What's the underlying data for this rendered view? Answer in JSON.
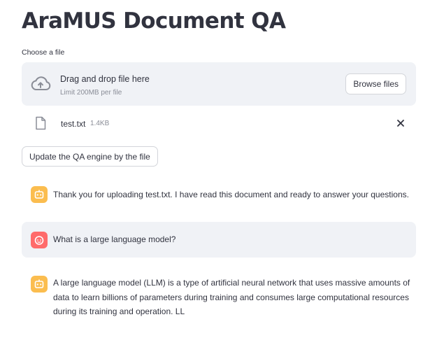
{
  "app": {
    "title": "AraMUS Document QA"
  },
  "uploader": {
    "label": "Choose a file",
    "drop_text": "Drag and drop file here",
    "limit_text": "Limit 200MB per file",
    "browse_label": "Browse files",
    "icon": "cloud-upload-icon"
  },
  "file": {
    "name": "test.txt",
    "size": "1.4KB",
    "icon": "file-icon",
    "remove_icon": "close-icon"
  },
  "update_button": {
    "label": "Update the QA engine by the file"
  },
  "chat": {
    "messages": [
      {
        "role": "assistant",
        "avatar_icon": "bot-icon",
        "avatar_color": "#fbbd4f",
        "text": "Thank you for uploading test.txt. I have read this document and ready to answer your questions."
      },
      {
        "role": "user",
        "avatar_icon": "user-face-icon",
        "avatar_color": "#ff6b6b",
        "text": "What is a large language model?"
      },
      {
        "role": "assistant",
        "avatar_icon": "bot-icon",
        "avatar_color": "#fbbd4f",
        "text": "A large language model (LLM) is a type of artificial neural network that uses massive amounts of data to learn billions of parameters during training and consumes large computational resources during its training and operation. LL"
      }
    ]
  },
  "colors": {
    "text": "#31333f",
    "muted": "#8a8d97",
    "surface": "#f0f2f6",
    "border": "#d3d5da"
  }
}
